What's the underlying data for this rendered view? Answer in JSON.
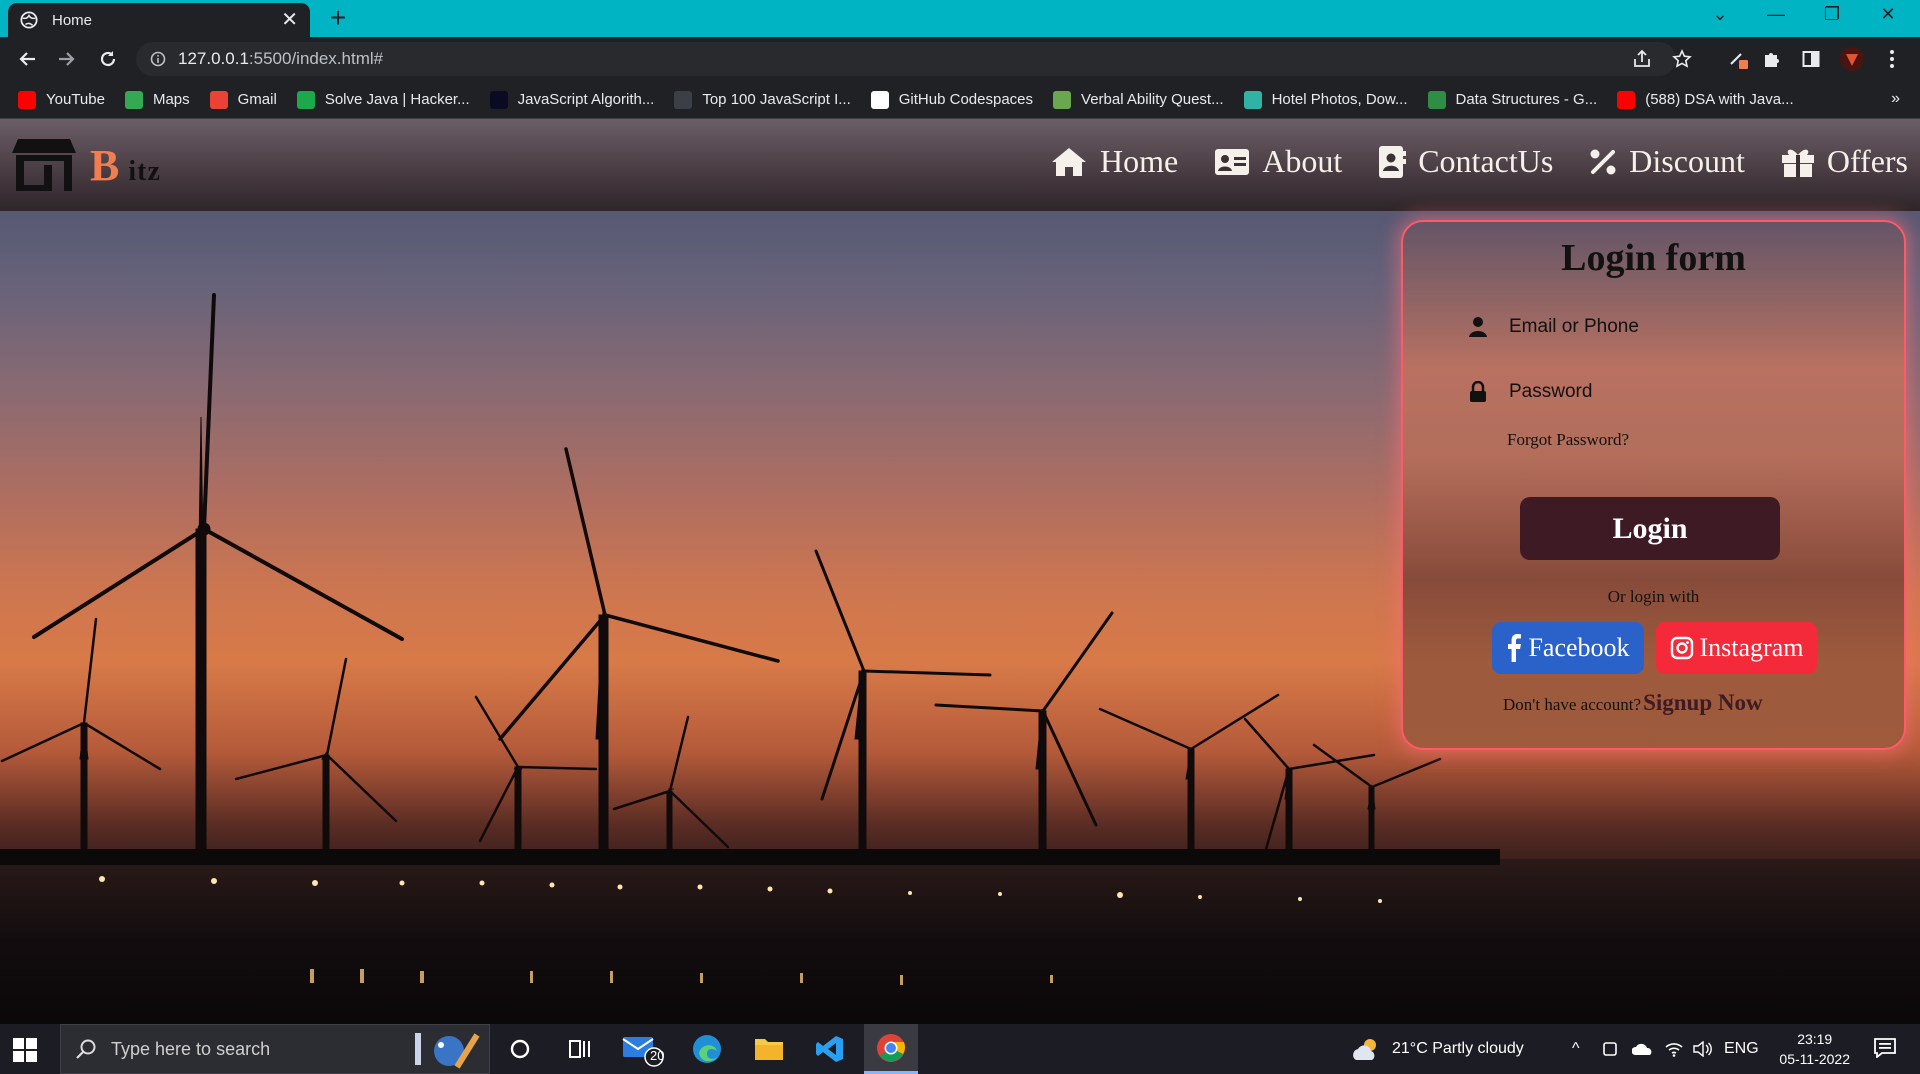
{
  "browser": {
    "tab_title": "Home",
    "url_host": "127.0.0.1",
    "url_rest": ":5500/index.html#",
    "bookmarks": [
      {
        "label": "YouTube",
        "icon": "youtube-icon",
        "color": "#ff0000"
      },
      {
        "label": "Maps",
        "icon": "maps-icon",
        "color": "#34a853"
      },
      {
        "label": "Gmail",
        "icon": "gmail-icon",
        "color": "#ea4335"
      },
      {
        "label": "Solve Java | Hacker...",
        "icon": "hackerrank-icon",
        "color": "#1ba94c"
      },
      {
        "label": "JavaScript Algorith...",
        "icon": "freecodecamp-icon",
        "color": "#0a0a23"
      },
      {
        "label": "Top 100 JavaScript I...",
        "icon": "site-icon",
        "color": "#3c3f46"
      },
      {
        "label": "GitHub Codespaces",
        "icon": "github-icon",
        "color": "#ffffff"
      },
      {
        "label": "Verbal Ability Quest...",
        "icon": "leaf-icon",
        "color": "#6aa84f"
      },
      {
        "label": "Hotel Photos, Dow...",
        "icon": "photos-icon",
        "color": "#30b3a5"
      },
      {
        "label": "Data Structures - G...",
        "icon": "geeksforgeeks-icon",
        "color": "#2f8d46"
      },
      {
        "label": "(588) DSA with Java...",
        "icon": "youtube-icon",
        "color": "#ff0000"
      }
    ],
    "more": "»"
  },
  "site": {
    "brand_initial": "B",
    "brand_rest": "itz",
    "nav": [
      {
        "label": "Home",
        "icon": "home-icon"
      },
      {
        "label": "About",
        "icon": "id-card-icon"
      },
      {
        "label": "ContactUs",
        "icon": "contact-icon"
      },
      {
        "label": "Discount",
        "icon": "percent-icon"
      },
      {
        "label": "Offers",
        "icon": "gift-icon"
      }
    ]
  },
  "login": {
    "title": "Login form",
    "email_placeholder": "Email or Phone",
    "password_placeholder": "Password",
    "forgot": "Forgot Password?",
    "button": "Login",
    "or_text": "Or login with",
    "facebook": "Facebook",
    "instagram": "Instagram",
    "no_account": "Don't have account?",
    "signup": "Signup Now"
  },
  "taskbar": {
    "search_placeholder": "Type here to search",
    "mail_badge": "20",
    "weather": "21°C  Partly cloudy",
    "language": "ENG",
    "time": "23:19",
    "date": "05-11-2022"
  },
  "colors": {
    "accent": "#00b4c4",
    "brand_orange": "#f07e50",
    "login_button": "#3d1a24",
    "facebook": "#2a62c9",
    "instagram": "#f42a3a"
  }
}
